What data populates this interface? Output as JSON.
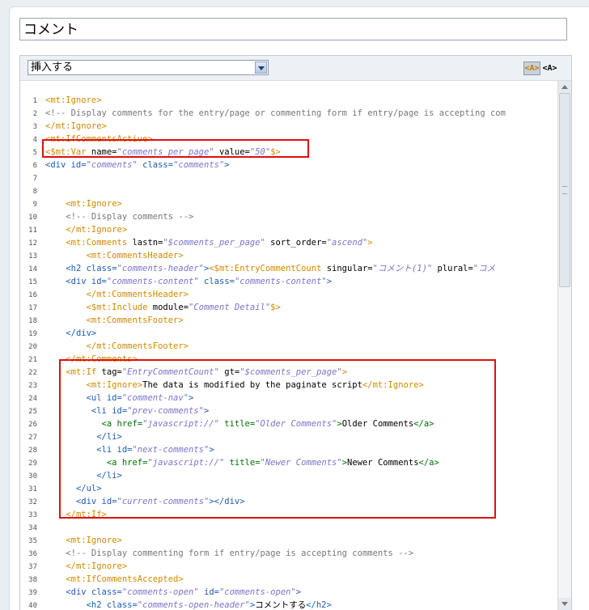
{
  "entry": {
    "title_value": "コメント"
  },
  "toolbar": {
    "insert_select": "挿入する",
    "format_rich": "<A>",
    "format_plain": "<A>"
  },
  "code_lines": [
    {
      "n": "1",
      "segs": [
        [
          "tg",
          "<mt:Ignore>"
        ]
      ]
    },
    {
      "n": "2",
      "segs": [
        [
          "cm",
          "<!-- Display comments for the entry/page or commenting form if entry/page is accepting com"
        ]
      ]
    },
    {
      "n": "3",
      "segs": [
        [
          "tg",
          "</mt:Ignore>"
        ]
      ]
    },
    {
      "n": "4",
      "segs": [
        [
          "tg",
          "<mt:IfCommentsActive>"
        ]
      ]
    },
    {
      "n": "5",
      "segs": [
        [
          "tg",
          "<$mt:Var"
        ],
        [
          "tx",
          " name="
        ],
        [
          "st",
          "\"comments_per_page\""
        ],
        [
          "tx",
          " value="
        ],
        [
          "st",
          "\"50\""
        ],
        [
          "tg",
          "$>"
        ]
      ]
    },
    {
      "n": "6",
      "segs": [
        [
          "at",
          "<div id="
        ],
        [
          "st",
          "\"comments\""
        ],
        [
          "at",
          " class="
        ],
        [
          "st",
          "\"comments\""
        ],
        [
          "at",
          ">"
        ]
      ]
    },
    {
      "n": "7",
      "segs": []
    },
    {
      "n": "8",
      "segs": []
    },
    {
      "n": "9",
      "segs": [
        [
          "tx",
          "    "
        ],
        [
          "tg",
          "<mt:Ignore>"
        ]
      ]
    },
    {
      "n": "10",
      "segs": [
        [
          "tx",
          "    "
        ],
        [
          "cm",
          "<!-- Display comments -->"
        ]
      ]
    },
    {
      "n": "11",
      "segs": [
        [
          "tx",
          "    "
        ],
        [
          "tg",
          "</mt:Ignore>"
        ]
      ]
    },
    {
      "n": "12",
      "segs": [
        [
          "tx",
          "    "
        ],
        [
          "tg",
          "<mt:Comments"
        ],
        [
          "tx",
          " lastn="
        ],
        [
          "st",
          "\"$comments_per_page\""
        ],
        [
          "tx",
          " sort_order="
        ],
        [
          "st",
          "\"ascend\""
        ],
        [
          "tg",
          ">"
        ]
      ]
    },
    {
      "n": "13",
      "segs": [
        [
          "tx",
          "        "
        ],
        [
          "tg",
          "<mt:CommentsHeader>"
        ]
      ]
    },
    {
      "n": "14",
      "segs": [
        [
          "tx",
          "    "
        ],
        [
          "at",
          "<h2 class="
        ],
        [
          "st",
          "\"comments-header\""
        ],
        [
          "at",
          ">"
        ],
        [
          "tg",
          "<$mt:EntryCommentCount"
        ],
        [
          "tx",
          " singular="
        ],
        [
          "st",
          "\"コメント(1)\""
        ],
        [
          "tx",
          " plural="
        ],
        [
          "st",
          "\"コメ"
        ]
      ]
    },
    {
      "n": "15",
      "segs": [
        [
          "tx",
          "    "
        ],
        [
          "at",
          "<div id="
        ],
        [
          "st",
          "\"comments-content\""
        ],
        [
          "at",
          " class="
        ],
        [
          "st",
          "\"comments-content\""
        ],
        [
          "at",
          ">"
        ]
      ]
    },
    {
      "n": "16",
      "segs": [
        [
          "tx",
          "        "
        ],
        [
          "tg",
          "</mt:CommentsHeader>"
        ]
      ]
    },
    {
      "n": "17",
      "segs": [
        [
          "tx",
          "        "
        ],
        [
          "tg",
          "<$mt:Include"
        ],
        [
          "tx",
          " module="
        ],
        [
          "st",
          "\"Comment Detail\""
        ],
        [
          "tg",
          "$>"
        ]
      ]
    },
    {
      "n": "18",
      "segs": [
        [
          "tx",
          "        "
        ],
        [
          "tg",
          "<mt:CommentsFooter>"
        ]
      ]
    },
    {
      "n": "19",
      "segs": [
        [
          "tx",
          "    "
        ],
        [
          "at",
          "</div>"
        ]
      ]
    },
    {
      "n": "20",
      "segs": [
        [
          "tx",
          "        "
        ],
        [
          "tg",
          "</mt:CommentsFooter>"
        ]
      ]
    },
    {
      "n": "21",
      "segs": [
        [
          "tx",
          "    "
        ],
        [
          "tg",
          "</mt:Comments>"
        ]
      ]
    },
    {
      "n": "22",
      "segs": [
        [
          "tx",
          "    "
        ],
        [
          "tg",
          "<mt:If"
        ],
        [
          "tx",
          " tag="
        ],
        [
          "st",
          "\"EntryCommentCount\""
        ],
        [
          "tx",
          " gt="
        ],
        [
          "st",
          "\"$comments_per_page\""
        ],
        [
          "tg",
          ">"
        ]
      ]
    },
    {
      "n": "23",
      "segs": [
        [
          "tx",
          "        "
        ],
        [
          "tg",
          "<mt:Ignore>"
        ],
        [
          "tx",
          "The data is modified by the paginate script"
        ],
        [
          "tg",
          "</mt:Ignore>"
        ]
      ]
    },
    {
      "n": "24",
      "segs": [
        [
          "tx",
          "        "
        ],
        [
          "at",
          "<ul id="
        ],
        [
          "st",
          "\"comment-nav\""
        ],
        [
          "at",
          ">"
        ]
      ]
    },
    {
      "n": "25",
      "segs": [
        [
          "tx",
          "         "
        ],
        [
          "at",
          "<li id="
        ],
        [
          "st",
          "\"prev-comments\""
        ],
        [
          "at",
          ">"
        ]
      ]
    },
    {
      "n": "26",
      "segs": [
        [
          "tx",
          "           "
        ],
        [
          "hl",
          "<a href="
        ],
        [
          "st",
          "\"javascript://\""
        ],
        [
          "hl",
          " title="
        ],
        [
          "st",
          "\"Older Comments\""
        ],
        [
          "hl",
          ">"
        ],
        [
          "tx",
          "Older Comments"
        ],
        [
          "hl",
          "</a>"
        ]
      ]
    },
    {
      "n": "27",
      "segs": [
        [
          "tx",
          "          "
        ],
        [
          "at",
          "</li>"
        ]
      ]
    },
    {
      "n": "28",
      "segs": [
        [
          "tx",
          "          "
        ],
        [
          "at",
          "<li id="
        ],
        [
          "st",
          "\"next-comments\""
        ],
        [
          "at",
          ">"
        ]
      ]
    },
    {
      "n": "29",
      "segs": [
        [
          "tx",
          "            "
        ],
        [
          "hl",
          "<a href="
        ],
        [
          "st",
          "\"javascript://\""
        ],
        [
          "hl",
          " title="
        ],
        [
          "st",
          "\"Newer Comments\""
        ],
        [
          "hl",
          ">"
        ],
        [
          "tx",
          "Newer Comments"
        ],
        [
          "hl",
          "</a>"
        ]
      ]
    },
    {
      "n": "30",
      "segs": [
        [
          "tx",
          "          "
        ],
        [
          "at",
          "</li>"
        ]
      ]
    },
    {
      "n": "31",
      "segs": [
        [
          "tx",
          "      "
        ],
        [
          "at",
          "</ul>"
        ]
      ]
    },
    {
      "n": "32",
      "segs": [
        [
          "tx",
          "      "
        ],
        [
          "at",
          "<div id="
        ],
        [
          "st",
          "\"current-comments\""
        ],
        [
          "at",
          "></div>"
        ]
      ]
    },
    {
      "n": "33",
      "segs": [
        [
          "tx",
          "    "
        ],
        [
          "tg",
          "</mt:If>"
        ]
      ]
    },
    {
      "n": "34",
      "segs": []
    },
    {
      "n": "35",
      "segs": [
        [
          "tx",
          "    "
        ],
        [
          "tg",
          "<mt:Ignore>"
        ]
      ]
    },
    {
      "n": "36",
      "segs": [
        [
          "tx",
          "    "
        ],
        [
          "cm",
          "<!-- Display commenting form if entry/page is accepting comments -->"
        ]
      ]
    },
    {
      "n": "37",
      "segs": [
        [
          "tx",
          "    "
        ],
        [
          "tg",
          "</mt:Ignore>"
        ]
      ]
    },
    {
      "n": "38",
      "segs": [
        [
          "tx",
          "    "
        ],
        [
          "tg",
          "<mt:IfCommentsAccepted>"
        ]
      ]
    },
    {
      "n": "39",
      "segs": [
        [
          "tx",
          "    "
        ],
        [
          "at",
          "<div class="
        ],
        [
          "st",
          "\"comments-open\""
        ],
        [
          "at",
          " id="
        ],
        [
          "st",
          "\"comments-open\""
        ],
        [
          "at",
          ">"
        ]
      ]
    },
    {
      "n": "40",
      "segs": [
        [
          "tx",
          "        "
        ],
        [
          "at",
          "<h2 class="
        ],
        [
          "st",
          "\"comments-open-header\""
        ],
        [
          "at",
          ">"
        ],
        [
          "tx",
          "コメントする"
        ],
        [
          "at",
          "</h2>"
        ]
      ]
    }
  ]
}
